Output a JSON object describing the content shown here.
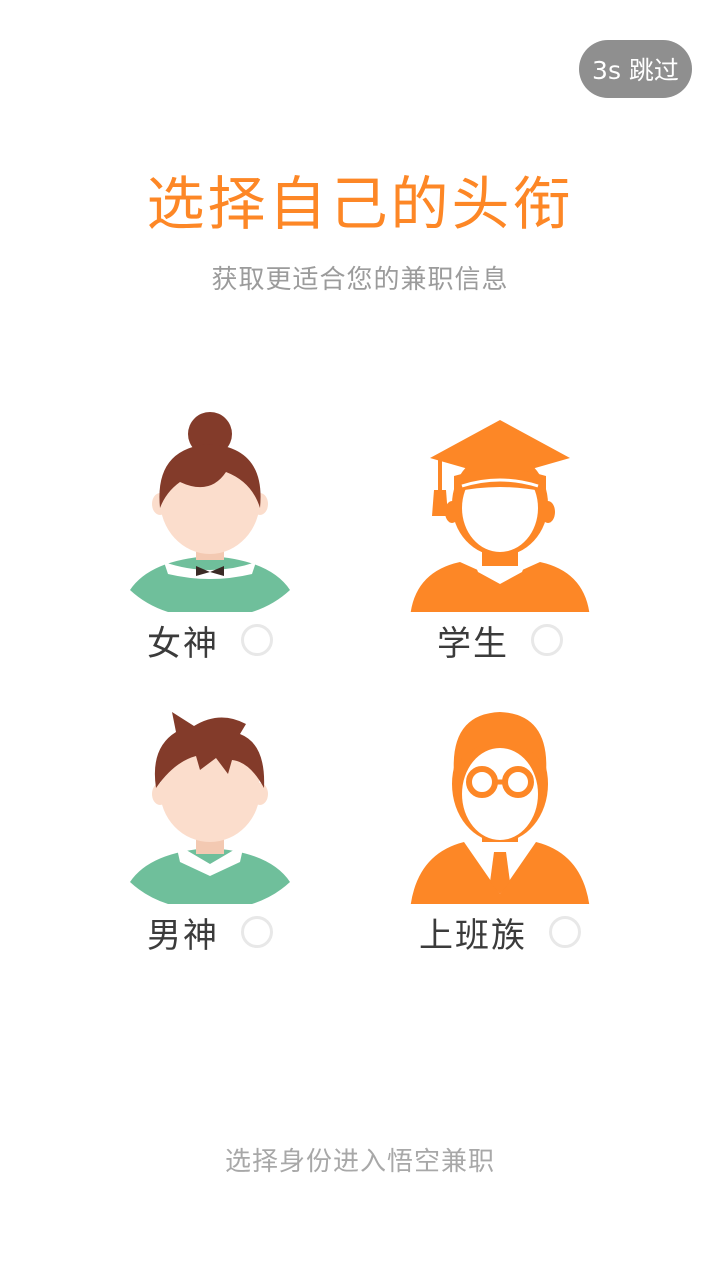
{
  "skip": {
    "label": "3s 跳过"
  },
  "header": {
    "title": "选择自己的头衔",
    "subtitle": "获取更适合您的兼职信息"
  },
  "options": [
    {
      "label": "女神",
      "icon": "goddess-avatar-icon",
      "selected": false
    },
    {
      "label": "学生",
      "icon": "student-avatar-icon",
      "selected": false
    },
    {
      "label": "男神",
      "icon": "male-god-avatar-icon",
      "selected": false
    },
    {
      "label": "上班族",
      "icon": "office-worker-avatar-icon",
      "selected": false
    }
  ],
  "footer": {
    "text": "选择身份进入悟空兼职"
  },
  "colors": {
    "accent": "#fd8726",
    "green": "#6fbf9b",
    "hair": "#833b2a",
    "skin": "#fbddcc",
    "skip_bg": "#8f8f8f"
  }
}
